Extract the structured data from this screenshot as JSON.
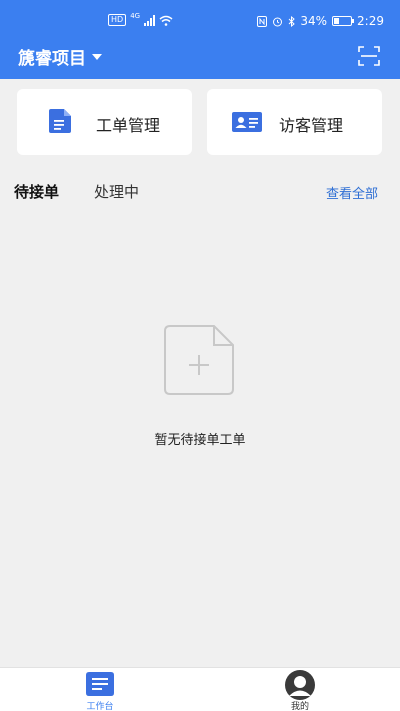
{
  "status_bar": {
    "network_badge": "HD",
    "network_type": "4G",
    "battery_text": "34%",
    "battery_level": 0.34,
    "time": "2:29"
  },
  "header": {
    "project_title": "篪睿项目",
    "accent_color": "#3b7ff0"
  },
  "quick_actions": [
    {
      "label": "工单管理",
      "icon": "document-icon"
    },
    {
      "label": "访客管理",
      "icon": "id-card-icon"
    }
  ],
  "tabs": {
    "pending": "待接单",
    "processing": "处理中",
    "view_all": "查看全部",
    "active": "pending"
  },
  "empty_state": {
    "message": "暂无待接单工单",
    "icon": "empty-document-plus-icon"
  },
  "bottom_nav": {
    "items": [
      {
        "label": "工作台",
        "icon": "workbench-icon",
        "active": true
      },
      {
        "label": "我的",
        "icon": "profile-avatar-icon",
        "active": false
      }
    ]
  }
}
